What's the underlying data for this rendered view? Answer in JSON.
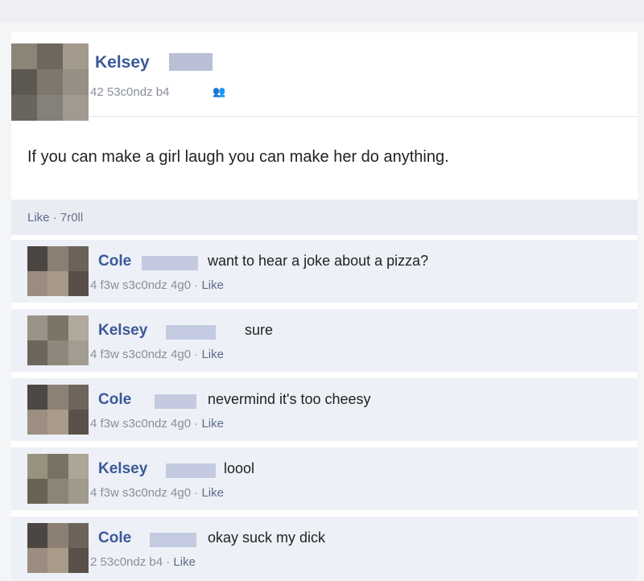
{
  "post": {
    "author": "Kelsey",
    "meta": "42 53c0ndz b4",
    "text": "If you can make a girl laugh you can make her do anything.",
    "actions": {
      "like": "Like",
      "separator": " · ",
      "extra": "7r0ll"
    }
  },
  "comments": [
    {
      "author": "Cole",
      "text": "want to hear a joke about a pizza?",
      "time": "4 f3w s3c0ndz 4g0",
      "like": "Like"
    },
    {
      "author": "Kelsey",
      "text": "sure",
      "time": "4 f3w s3c0ndz 4g0",
      "like": "Like"
    },
    {
      "author": "Cole",
      "text": "nevermind it's too cheesy",
      "time": "4 f3w s3c0ndz 4g0",
      "like": "Like"
    },
    {
      "author": "Kelsey",
      "text": "loool",
      "time": "4 f3w s3c0ndz 4g0",
      "like": "Like"
    },
    {
      "author": "Cole",
      "text": "okay suck my dick",
      "time": "2 53c0ndz b4",
      "like": "Like"
    }
  ],
  "icons": {
    "audience": "friends-icon"
  },
  "colors": {
    "name_link": "#3b5998",
    "meta_text": "#8a8f9c",
    "comment_bg": "#edf0f6",
    "actions_bg": "#e9ecf3"
  }
}
